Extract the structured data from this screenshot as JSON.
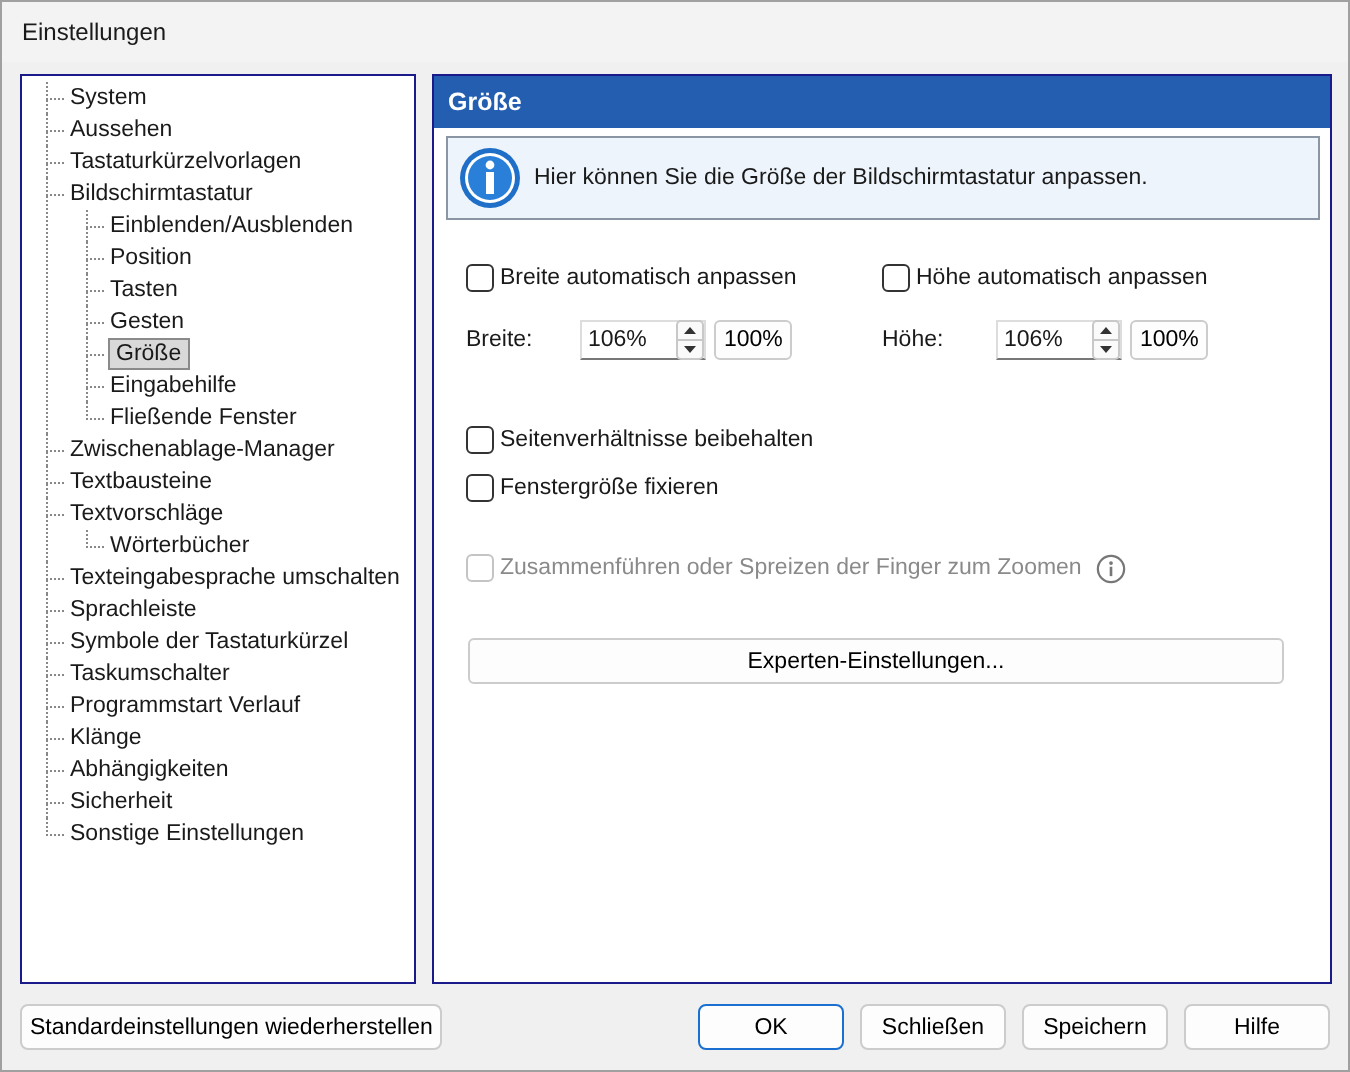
{
  "window": {
    "title": "Einstellungen"
  },
  "tree": [
    {
      "label": "System",
      "selected": false
    },
    {
      "label": "Aussehen",
      "selected": false
    },
    {
      "label": "Tastaturkürzelvorlagen",
      "selected": false
    },
    {
      "label": "Bildschirmtastatur",
      "selected": false,
      "children": [
        {
          "label": "Einblenden/Ausblenden",
          "selected": false
        },
        {
          "label": "Position",
          "selected": false
        },
        {
          "label": "Tasten",
          "selected": false
        },
        {
          "label": "Gesten",
          "selected": false
        },
        {
          "label": "Größe",
          "selected": true
        },
        {
          "label": "Eingabehilfe",
          "selected": false
        },
        {
          "label": "Fließende Fenster",
          "selected": false
        }
      ]
    },
    {
      "label": "Zwischenablage-Manager",
      "selected": false
    },
    {
      "label": "Textbausteine",
      "selected": false
    },
    {
      "label": "Textvorschläge",
      "selected": false,
      "children": [
        {
          "label": "Wörterbücher",
          "selected": false
        }
      ]
    },
    {
      "label": "Texteingabesprache umschalten",
      "selected": false
    },
    {
      "label": "Sprachleiste",
      "selected": false
    },
    {
      "label": "Symbole der Tastaturkürzel",
      "selected": false
    },
    {
      "label": "Taskumschalter",
      "selected": false
    },
    {
      "label": "Programmstart Verlauf",
      "selected": false
    },
    {
      "label": "Klänge",
      "selected": false
    },
    {
      "label": "Abhängigkeiten",
      "selected": false
    },
    {
      "label": "Sicherheit",
      "selected": false
    },
    {
      "label": "Sonstige Einstellungen",
      "selected": false
    }
  ],
  "panel": {
    "title": "Größe",
    "info": "Hier können Sie die Größe der Bildschirmtastatur anpassen.",
    "auto_checks": [
      {
        "label": "Breite automatisch anpassen",
        "checked": false
      },
      {
        "label": "Höhe automatisch anpassen",
        "checked": false
      }
    ],
    "sizes": [
      {
        "label": "Breite:",
        "value": "106%",
        "reset": "100%"
      },
      {
        "label": "Höhe:",
        "value": "106%",
        "reset": "100%"
      }
    ],
    "options": [
      {
        "label": "Seitenverhältnisse beibehalten",
        "checked": false,
        "disabled": false,
        "info": false
      },
      {
        "label": "Fenstergröße fixieren",
        "checked": false,
        "disabled": false,
        "info": false
      },
      {
        "label": "Zusammenführen oder Spreizen der Finger zum Zoomen",
        "checked": false,
        "disabled": true,
        "info": true
      }
    ],
    "expert_button": "Experten-Einstellungen..."
  },
  "reset_button": "Standardeinstellungen wiederherstellen",
  "buttons": [
    {
      "label": "OK",
      "default": true
    },
    {
      "label": "Schließen",
      "default": false
    },
    {
      "label": "Speichern",
      "default": false
    },
    {
      "label": "Hilfe",
      "default": false
    }
  ]
}
